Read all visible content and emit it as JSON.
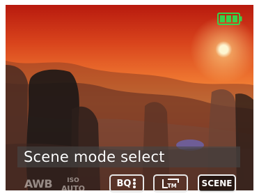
{
  "screen": {
    "caption": "Scene mode select",
    "modes": [
      {
        "id": "awb",
        "label": "AWB",
        "selected": false
      },
      {
        "id": "iso",
        "label": "ISO AUTO",
        "line1": "ISO",
        "line2": "AUTO",
        "selected": false
      },
      {
        "id": "bq",
        "label": "BQ",
        "selected": false
      },
      {
        "id": "tm",
        "label": "TM",
        "selected": false
      },
      {
        "id": "scene",
        "label": "SCENE",
        "selected": true
      }
    ],
    "battery": {
      "level": 1.0,
      "color": "#38d24a"
    },
    "colors": {
      "sky_top": "#b81a0e",
      "sky_mid": "#f07a32",
      "caption_bg": "#464646"
    }
  }
}
